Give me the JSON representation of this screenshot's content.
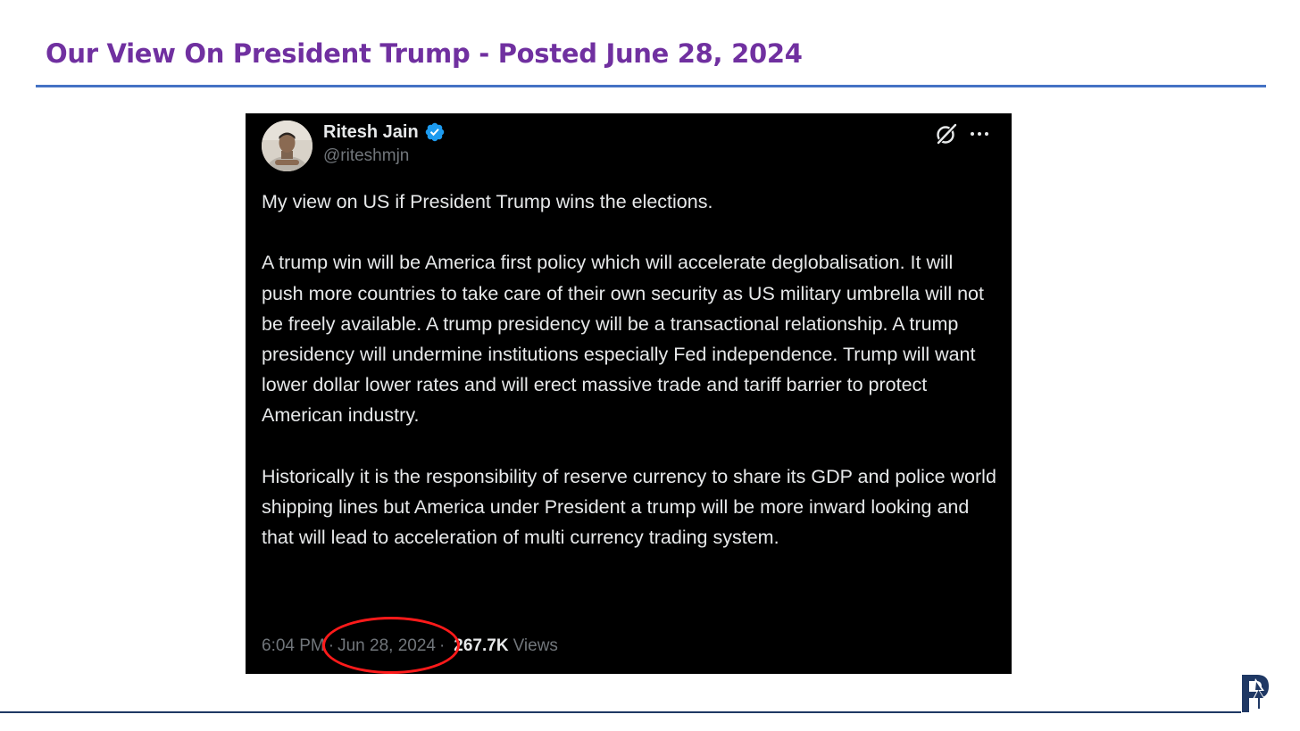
{
  "slide": {
    "title": "Our View On President Trump - Posted June 28, 2024"
  },
  "tweet": {
    "author_name": "Ritesh Jain",
    "handle": "@riteshmjn",
    "paragraphs": [
      "My view on US if President Trump wins the elections.",
      "A trump win will be America first policy which will accelerate deglobalisation. It will push more countries to take care of their own security as US military umbrella will not be freely available. A trump presidency will be a transactional relationship. A trump presidency will undermine institutions especially Fed independence. Trump will want lower dollar lower rates and will erect massive trade and tariff barrier to protect American industry.",
      "Historically it is the responsibility of reserve currency to share its GDP and police world shipping lines but America under President a trump will be more inward looking and that will lead to acceleration of multi currency trading system."
    ],
    "time": "6:04 PM",
    "separator": "·",
    "date": "Jun 28, 2024",
    "views_count": "267.7K",
    "views_label": "Views"
  },
  "colors": {
    "title": "#7030A0",
    "title_rule": "#4472C4",
    "tweet_background": "#000000",
    "tweet_text": "#e7e9ea",
    "tweet_muted": "#71767b",
    "verified": "#1d9bf0",
    "highlight": "#ff1a1a",
    "logo": "#1f3864"
  },
  "icons": {
    "verified": "verified-badge-icon",
    "grok": "grok-icon",
    "more": "more-options-icon",
    "avatar": "avatar",
    "logo": "company-logo"
  }
}
